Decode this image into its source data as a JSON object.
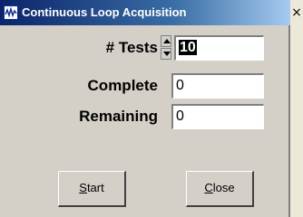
{
  "window": {
    "title": "Continuous Loop Acquisition",
    "close_glyph": "×"
  },
  "icons": {
    "app": "waveform-app-icon",
    "spin_up": "spinner-up-arrow-icon",
    "spin_down": "spinner-down-arrow-icon"
  },
  "form": {
    "tests_label": "# Tests",
    "tests_value": "10",
    "complete_label": "Complete",
    "complete_value": "0",
    "remaining_label": "Remaining",
    "remaining_value": "0"
  },
  "buttons": {
    "start_mnemonic": "S",
    "start_rest": "tart",
    "close_mnemonic": "C",
    "close_rest": "lose"
  },
  "colors": {
    "titlebar": "#0a246a",
    "dialog_bg": "#d4d0c8"
  }
}
